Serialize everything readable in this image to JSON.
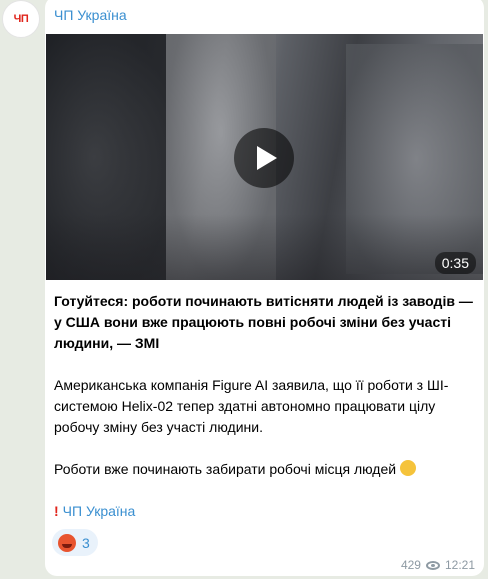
{
  "channel": {
    "name": "ЧП Україна",
    "avatar_text": "ЧП"
  },
  "video": {
    "duration": "0:35"
  },
  "post": {
    "headline": "Готуйтеся: роботи починають витісняти людей із заводів — у США вони вже працюють повні робочі зміни без участі людини, — ЗМІ",
    "body": "Американська компанія Figure AI заявила, що її роботи з ШІ-системою Helix-02 тепер здатні автономно працювати цілу робочу зміну без участі людини.",
    "closing": "Роботи вже починають забирати робочі місця людей",
    "signature_link": "ЧП Україна"
  },
  "reaction": {
    "count": "3"
  },
  "meta": {
    "views": "429",
    "time": "12:21"
  },
  "colors": {
    "accent": "#3a8fd0",
    "brand_red": "#e0241b",
    "background": "#e7ebe3"
  }
}
